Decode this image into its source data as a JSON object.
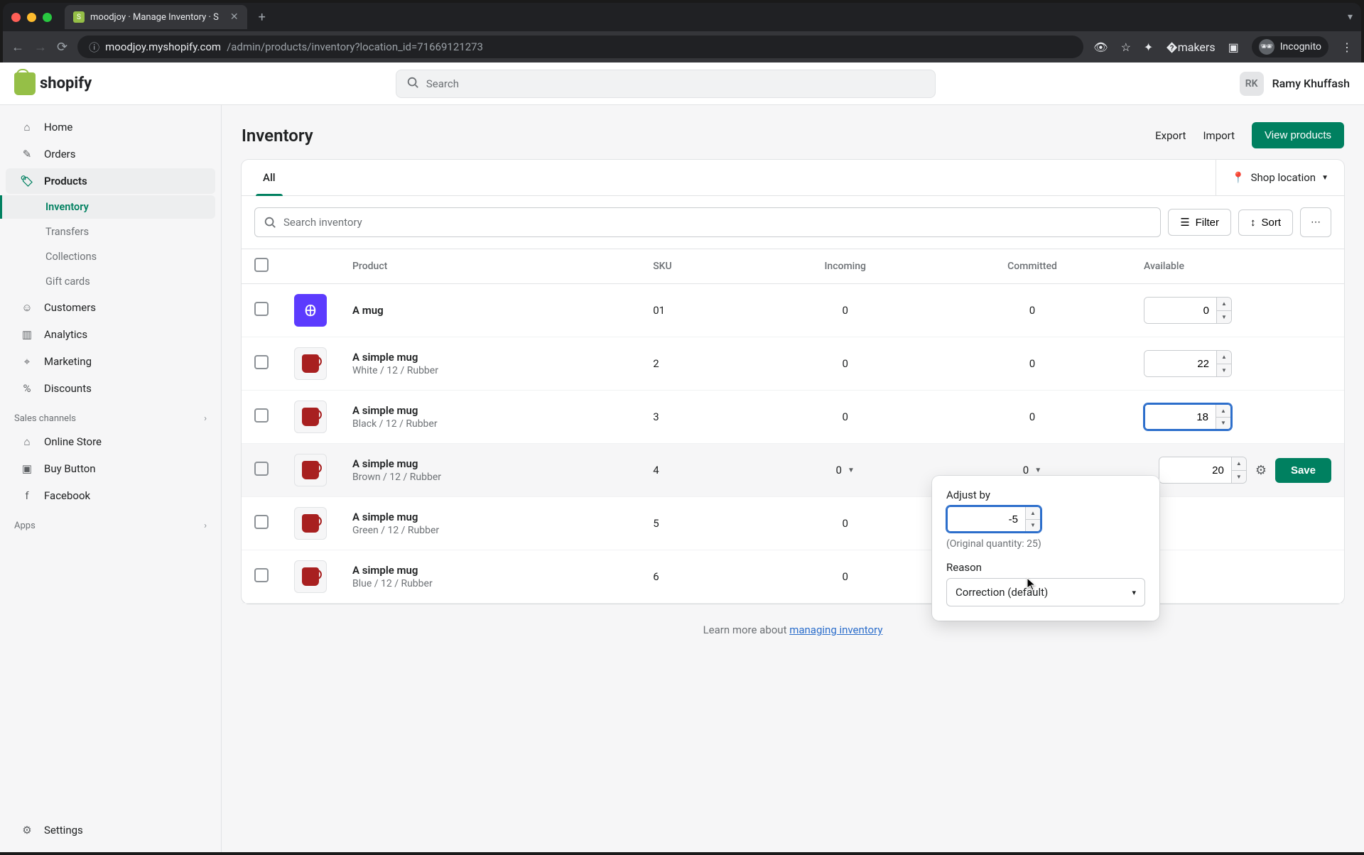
{
  "browser": {
    "tab_title": "moodjoy · Manage Inventory · S",
    "url_domain": "moodjoy.myshopify.com",
    "url_path": "/admin/products/inventory?location_id=71669121273",
    "incognito_label": "Incognito"
  },
  "header": {
    "logo_text": "shopify",
    "search_placeholder": "Search",
    "user_initials": "RK",
    "user_name": "Ramy Khuffash"
  },
  "sidebar": {
    "main": [
      {
        "label": "Home",
        "icon": "home"
      },
      {
        "label": "Orders",
        "icon": "orders"
      },
      {
        "label": "Products",
        "icon": "products",
        "active": true,
        "subs": [
          {
            "label": "Inventory",
            "current": true
          },
          {
            "label": "Transfers"
          },
          {
            "label": "Collections"
          },
          {
            "label": "Gift cards"
          }
        ]
      },
      {
        "label": "Customers",
        "icon": "customers"
      },
      {
        "label": "Analytics",
        "icon": "analytics"
      },
      {
        "label": "Marketing",
        "icon": "marketing"
      },
      {
        "label": "Discounts",
        "icon": "discounts"
      }
    ],
    "channels_label": "Sales channels",
    "channels": [
      {
        "label": "Online Store"
      },
      {
        "label": "Buy Button"
      },
      {
        "label": "Facebook"
      }
    ],
    "apps_label": "Apps",
    "settings_label": "Settings"
  },
  "page": {
    "title": "Inventory",
    "export": "Export",
    "import": "Import",
    "view_products": "View products",
    "tab_all": "All",
    "location": "Shop location",
    "search_placeholder": "Search inventory",
    "filter": "Filter",
    "sort": "Sort",
    "columns": {
      "product": "Product",
      "sku": "SKU",
      "incoming": "Incoming",
      "committed": "Committed",
      "available": "Available"
    },
    "save": "Save",
    "learn_prefix": "Learn more about ",
    "learn_link": "managing inventory"
  },
  "rows": [
    {
      "name": "A mug",
      "variant": "",
      "sku": "01",
      "incoming": "0",
      "committed": "0",
      "available": "0",
      "thumb": "bfly"
    },
    {
      "name": "A simple mug",
      "variant": "White / 12 / Rubber",
      "sku": "2",
      "incoming": "0",
      "committed": "0",
      "available": "22",
      "thumb": "mug"
    },
    {
      "name": "A simple mug",
      "variant": "Black / 12 / Rubber",
      "sku": "3",
      "incoming": "0",
      "committed": "0",
      "available": "18",
      "thumb": "mug",
      "focused": true
    },
    {
      "name": "A simple mug",
      "variant": "Brown / 12 / Rubber",
      "sku": "4",
      "incoming": "0",
      "committed": "0",
      "available": "20",
      "thumb": "mug",
      "editing": true
    },
    {
      "name": "A simple mug",
      "variant": "Green / 12 / Rubber",
      "sku": "5",
      "incoming": "0",
      "committed": "",
      "available": "",
      "thumb": "mug"
    },
    {
      "name": "A simple mug",
      "variant": "Blue / 12 / Rubber",
      "sku": "6",
      "incoming": "0",
      "committed": "",
      "available": "",
      "thumb": "mug"
    }
  ],
  "popover": {
    "adjust_label": "Adjust by",
    "adjust_value": "-5",
    "original": "(Original quantity: 25)",
    "reason_label": "Reason",
    "reason_value": "Correction (default)"
  }
}
